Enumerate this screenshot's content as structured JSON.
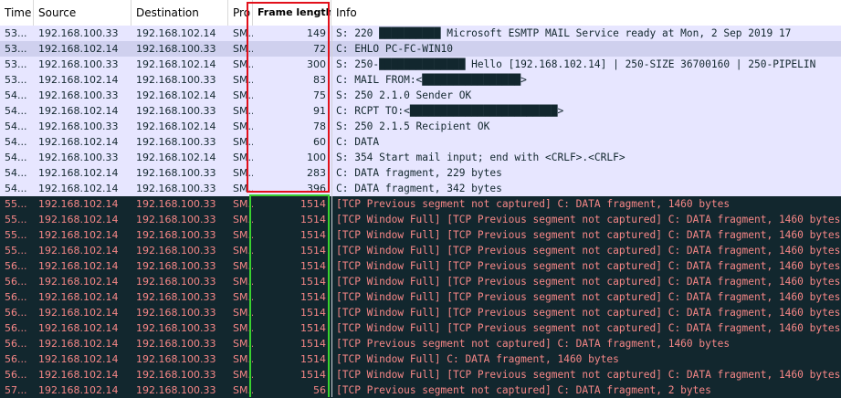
{
  "columns": [
    {
      "label": "Time"
    },
    {
      "label": "Source"
    },
    {
      "label": "Destination"
    },
    {
      "label": "Pro"
    },
    {
      "label": "Frame length c"
    },
    {
      "label": "Info"
    }
  ],
  "rows": [
    {
      "kind": "smtp",
      "selected": false,
      "time": "53...",
      "src": "192.168.100.33",
      "dst": "192.168.102.14",
      "proto": "SM...",
      "len": "149",
      "info": "S: 220 ██████████ Microsoft ESMTP MAIL Service ready at Mon, 2 Sep 2019 17"
    },
    {
      "kind": "smtp",
      "selected": true,
      "time": "53...",
      "src": "192.168.102.14",
      "dst": "192.168.100.33",
      "proto": "SM...",
      "len": "72",
      "info": "C: EHLO PC-FC-WIN10"
    },
    {
      "kind": "smtp",
      "selected": false,
      "time": "53...",
      "src": "192.168.100.33",
      "dst": "192.168.102.14",
      "proto": "SM...",
      "len": "300",
      "info": "S: 250-██████████████ Hello [192.168.102.14] | 250-SIZE 36700160 | 250-PIPELIN"
    },
    {
      "kind": "smtp",
      "selected": false,
      "time": "53...",
      "src": "192.168.102.14",
      "dst": "192.168.100.33",
      "proto": "SM...",
      "len": "83",
      "info": "C: MAIL FROM:<████████████████>"
    },
    {
      "kind": "smtp",
      "selected": false,
      "time": "54...",
      "src": "192.168.100.33",
      "dst": "192.168.102.14",
      "proto": "SM...",
      "len": "75",
      "info": "S: 250 2.1.0 Sender OK"
    },
    {
      "kind": "smtp",
      "selected": false,
      "time": "54...",
      "src": "192.168.102.14",
      "dst": "192.168.100.33",
      "proto": "SM...",
      "len": "91",
      "info": "C: RCPT TO:<████████████████████████>"
    },
    {
      "kind": "smtp",
      "selected": false,
      "time": "54...",
      "src": "192.168.100.33",
      "dst": "192.168.102.14",
      "proto": "SM...",
      "len": "78",
      "info": "S: 250 2.1.5 Recipient OK"
    },
    {
      "kind": "smtp",
      "selected": false,
      "time": "54...",
      "src": "192.168.102.14",
      "dst": "192.168.100.33",
      "proto": "SM...",
      "len": "60",
      "info": "C: DATA"
    },
    {
      "kind": "smtp",
      "selected": false,
      "time": "54...",
      "src": "192.168.100.33",
      "dst": "192.168.102.14",
      "proto": "SM...",
      "len": "100",
      "info": "S: 354 Start mail input; end with <CRLF>.<CRLF>"
    },
    {
      "kind": "smtp",
      "selected": false,
      "time": "54...",
      "src": "192.168.102.14",
      "dst": "192.168.100.33",
      "proto": "SM...",
      "len": "283",
      "info": "C: DATA fragment, 229 bytes"
    },
    {
      "kind": "smtp",
      "selected": false,
      "time": "54...",
      "src": "192.168.102.14",
      "dst": "192.168.100.33",
      "proto": "SM...",
      "len": "396",
      "info": "C: DATA fragment, 342 bytes"
    },
    {
      "kind": "bad",
      "selected": false,
      "time": "55...",
      "src": "192.168.102.14",
      "dst": "192.168.100.33",
      "proto": "SM...",
      "len": "1514",
      "info": "[TCP Previous segment not captured] C: DATA fragment, 1460 bytes"
    },
    {
      "kind": "bad",
      "selected": false,
      "time": "55...",
      "src": "192.168.102.14",
      "dst": "192.168.100.33",
      "proto": "SM...",
      "len": "1514",
      "info": "[TCP Window Full] [TCP Previous segment not captured] C: DATA fragment, 1460 bytes"
    },
    {
      "kind": "bad",
      "selected": false,
      "time": "55...",
      "src": "192.168.102.14",
      "dst": "192.168.100.33",
      "proto": "SM...",
      "len": "1514",
      "info": "[TCP Window Full] [TCP Previous segment not captured] C: DATA fragment, 1460 bytes"
    },
    {
      "kind": "bad",
      "selected": false,
      "time": "55...",
      "src": "192.168.102.14",
      "dst": "192.168.100.33",
      "proto": "SM...",
      "len": "1514",
      "info": "[TCP Window Full] [TCP Previous segment not captured] C: DATA fragment, 1460 bytes"
    },
    {
      "kind": "bad",
      "selected": false,
      "time": "56...",
      "src": "192.168.102.14",
      "dst": "192.168.100.33",
      "proto": "SM...",
      "len": "1514",
      "info": "[TCP Window Full] [TCP Previous segment not captured] C: DATA fragment, 1460 bytes"
    },
    {
      "kind": "bad",
      "selected": false,
      "time": "56...",
      "src": "192.168.102.14",
      "dst": "192.168.100.33",
      "proto": "SM...",
      "len": "1514",
      "info": "[TCP Window Full] [TCP Previous segment not captured] C: DATA fragment, 1460 bytes"
    },
    {
      "kind": "bad",
      "selected": false,
      "time": "56...",
      "src": "192.168.102.14",
      "dst": "192.168.100.33",
      "proto": "SM...",
      "len": "1514",
      "info": "[TCP Window Full] [TCP Previous segment not captured] C: DATA fragment, 1460 bytes"
    },
    {
      "kind": "bad",
      "selected": false,
      "time": "56...",
      "src": "192.168.102.14",
      "dst": "192.168.100.33",
      "proto": "SM...",
      "len": "1514",
      "info": "[TCP Window Full] [TCP Previous segment not captured] C: DATA fragment, 1460 bytes"
    },
    {
      "kind": "bad",
      "selected": false,
      "time": "56...",
      "src": "192.168.102.14",
      "dst": "192.168.100.33",
      "proto": "SM...",
      "len": "1514",
      "info": "[TCP Window Full] [TCP Previous segment not captured] C: DATA fragment, 1460 bytes"
    },
    {
      "kind": "bad",
      "selected": false,
      "time": "56...",
      "src": "192.168.102.14",
      "dst": "192.168.100.33",
      "proto": "SM...",
      "len": "1514",
      "info": "[TCP Previous segment not captured] C: DATA fragment, 1460 bytes"
    },
    {
      "kind": "bad",
      "selected": false,
      "time": "56...",
      "src": "192.168.102.14",
      "dst": "192.168.100.33",
      "proto": "SM...",
      "len": "1514",
      "info": "[TCP Window Full] C: DATA fragment, 1460 bytes"
    },
    {
      "kind": "bad",
      "selected": false,
      "time": "56...",
      "src": "192.168.102.14",
      "dst": "192.168.100.33",
      "proto": "SM...",
      "len": "1514",
      "info": "[TCP Window Full] [TCP Previous segment not captured] C: DATA fragment, 1460 bytes"
    },
    {
      "kind": "bad",
      "selected": false,
      "time": "57...",
      "src": "192.168.102.14",
      "dst": "192.168.100.33",
      "proto": "SM...",
      "len": "56",
      "info": "[TCP Previous segment not captured] C: DATA fragment, 2 bytes"
    }
  ],
  "colors": {
    "smtp_row_bg": "#e7e6ff",
    "selected_row_bg": "#cfd0ee",
    "bad_row_bg": "#12272e",
    "bad_row_text": "#f78787",
    "highlight_red": "#e2101b",
    "highlight_green": "#39d12f"
  }
}
